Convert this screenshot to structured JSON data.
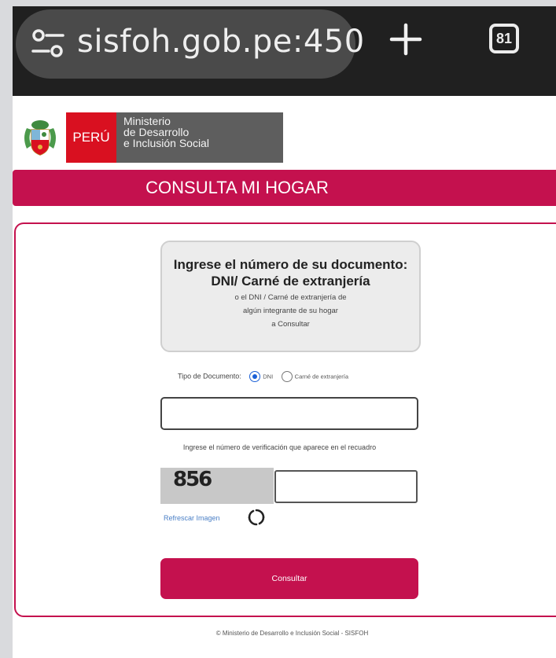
{
  "browser": {
    "url": "sisfoh.gob.pe:450",
    "tab_count": "81",
    "site_settings_icon": "tune-icon",
    "new_tab_icon": "plus-icon"
  },
  "gov_header": {
    "country": "PERÚ",
    "ministry_line1": "Ministerio",
    "ministry_line2": "de Desarrollo",
    "ministry_line3": "e Inclusión Social"
  },
  "page": {
    "title": "CONSULTA MI HOGAR",
    "accent_color": "#c4114e"
  },
  "info": {
    "heading1": "Ingrese el número de su documento:",
    "heading2": "DNI/ Carné de extranjería",
    "line1": "o el DNI / Carné de extranjería de",
    "line2": "algún integrante de su hogar",
    "line3": "a Consultar"
  },
  "form": {
    "doc_type_label": "Tipo de Documento:",
    "options": [
      {
        "label": "DNI",
        "checked": true
      },
      {
        "label": "Carné de extranjería",
        "checked": false
      }
    ],
    "document_number": "",
    "verification_instruction": "Ingrese el número de verificación que aparece en el recuadro",
    "captcha_text": "856",
    "captcha_value": "",
    "refresh_label": "Refrescar Imagen",
    "refresh_icon": "refresh-icon",
    "submit_label": "Consultar"
  },
  "footer": {
    "text": "© Ministerio de Desarrollo e Inclusión Social - SISFOH"
  }
}
